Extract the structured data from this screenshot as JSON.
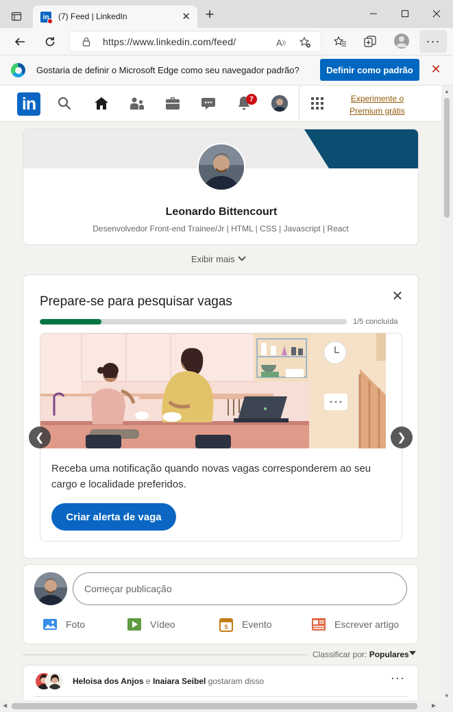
{
  "browser": {
    "tab_title": "(7) Feed | LinkedIn",
    "tab_close": "✕",
    "new_tab": "+",
    "url": "https://www.linkedin.com/feed/",
    "menu": "···",
    "infobar_text": "Gostaria de definir o Microsoft Edge como seu navegador padrão?",
    "infobar_button": "Definir como padrão",
    "infobar_close": "✕"
  },
  "nav": {
    "logo": "in",
    "notifications_count": "7",
    "premium_line1": "Experimente o",
    "premium_line2": "Premium grátis",
    "icons": [
      "search-icon",
      "home-icon",
      "network-icon",
      "jobs-icon",
      "messaging-icon",
      "notifications-icon",
      "apps-grid-icon"
    ]
  },
  "profile": {
    "name": "Leonardo Bittencourt",
    "headline": "Desenvolvedor Front-end Trainee/Jr | HTML | CSS | Javascript | React",
    "show_more": "Exibir mais"
  },
  "jobs": {
    "title": "Prepare-se para pesquisar vagas",
    "close": "✕",
    "progress_fraction": 0.2,
    "progress_label": "1/5 concluída",
    "description": "Receba uma notificação quando novas vagas corresponderem ao seu cargo e localidade preferidos.",
    "button": "Criar alerta de vaga",
    "prev": "❮",
    "next": "❯"
  },
  "share": {
    "placeholder": "Começar publicação",
    "actions": {
      "photo": "Foto",
      "video": "Vídeo",
      "event": "Evento",
      "article": "Escrever artigo"
    }
  },
  "sort": {
    "label": "Classificar por:",
    "value": "Populares"
  },
  "post": {
    "liker1": "Heloisa dos Anjos",
    "conj": "e",
    "liker2": "Inaiara Seibel",
    "suffix": "gostaram disso",
    "more": "···"
  },
  "colors": {
    "linkedin_blue": "#0a66c2",
    "progress_green": "#057642",
    "edge_button": "#0067c0",
    "premium_gold": "#915907"
  }
}
